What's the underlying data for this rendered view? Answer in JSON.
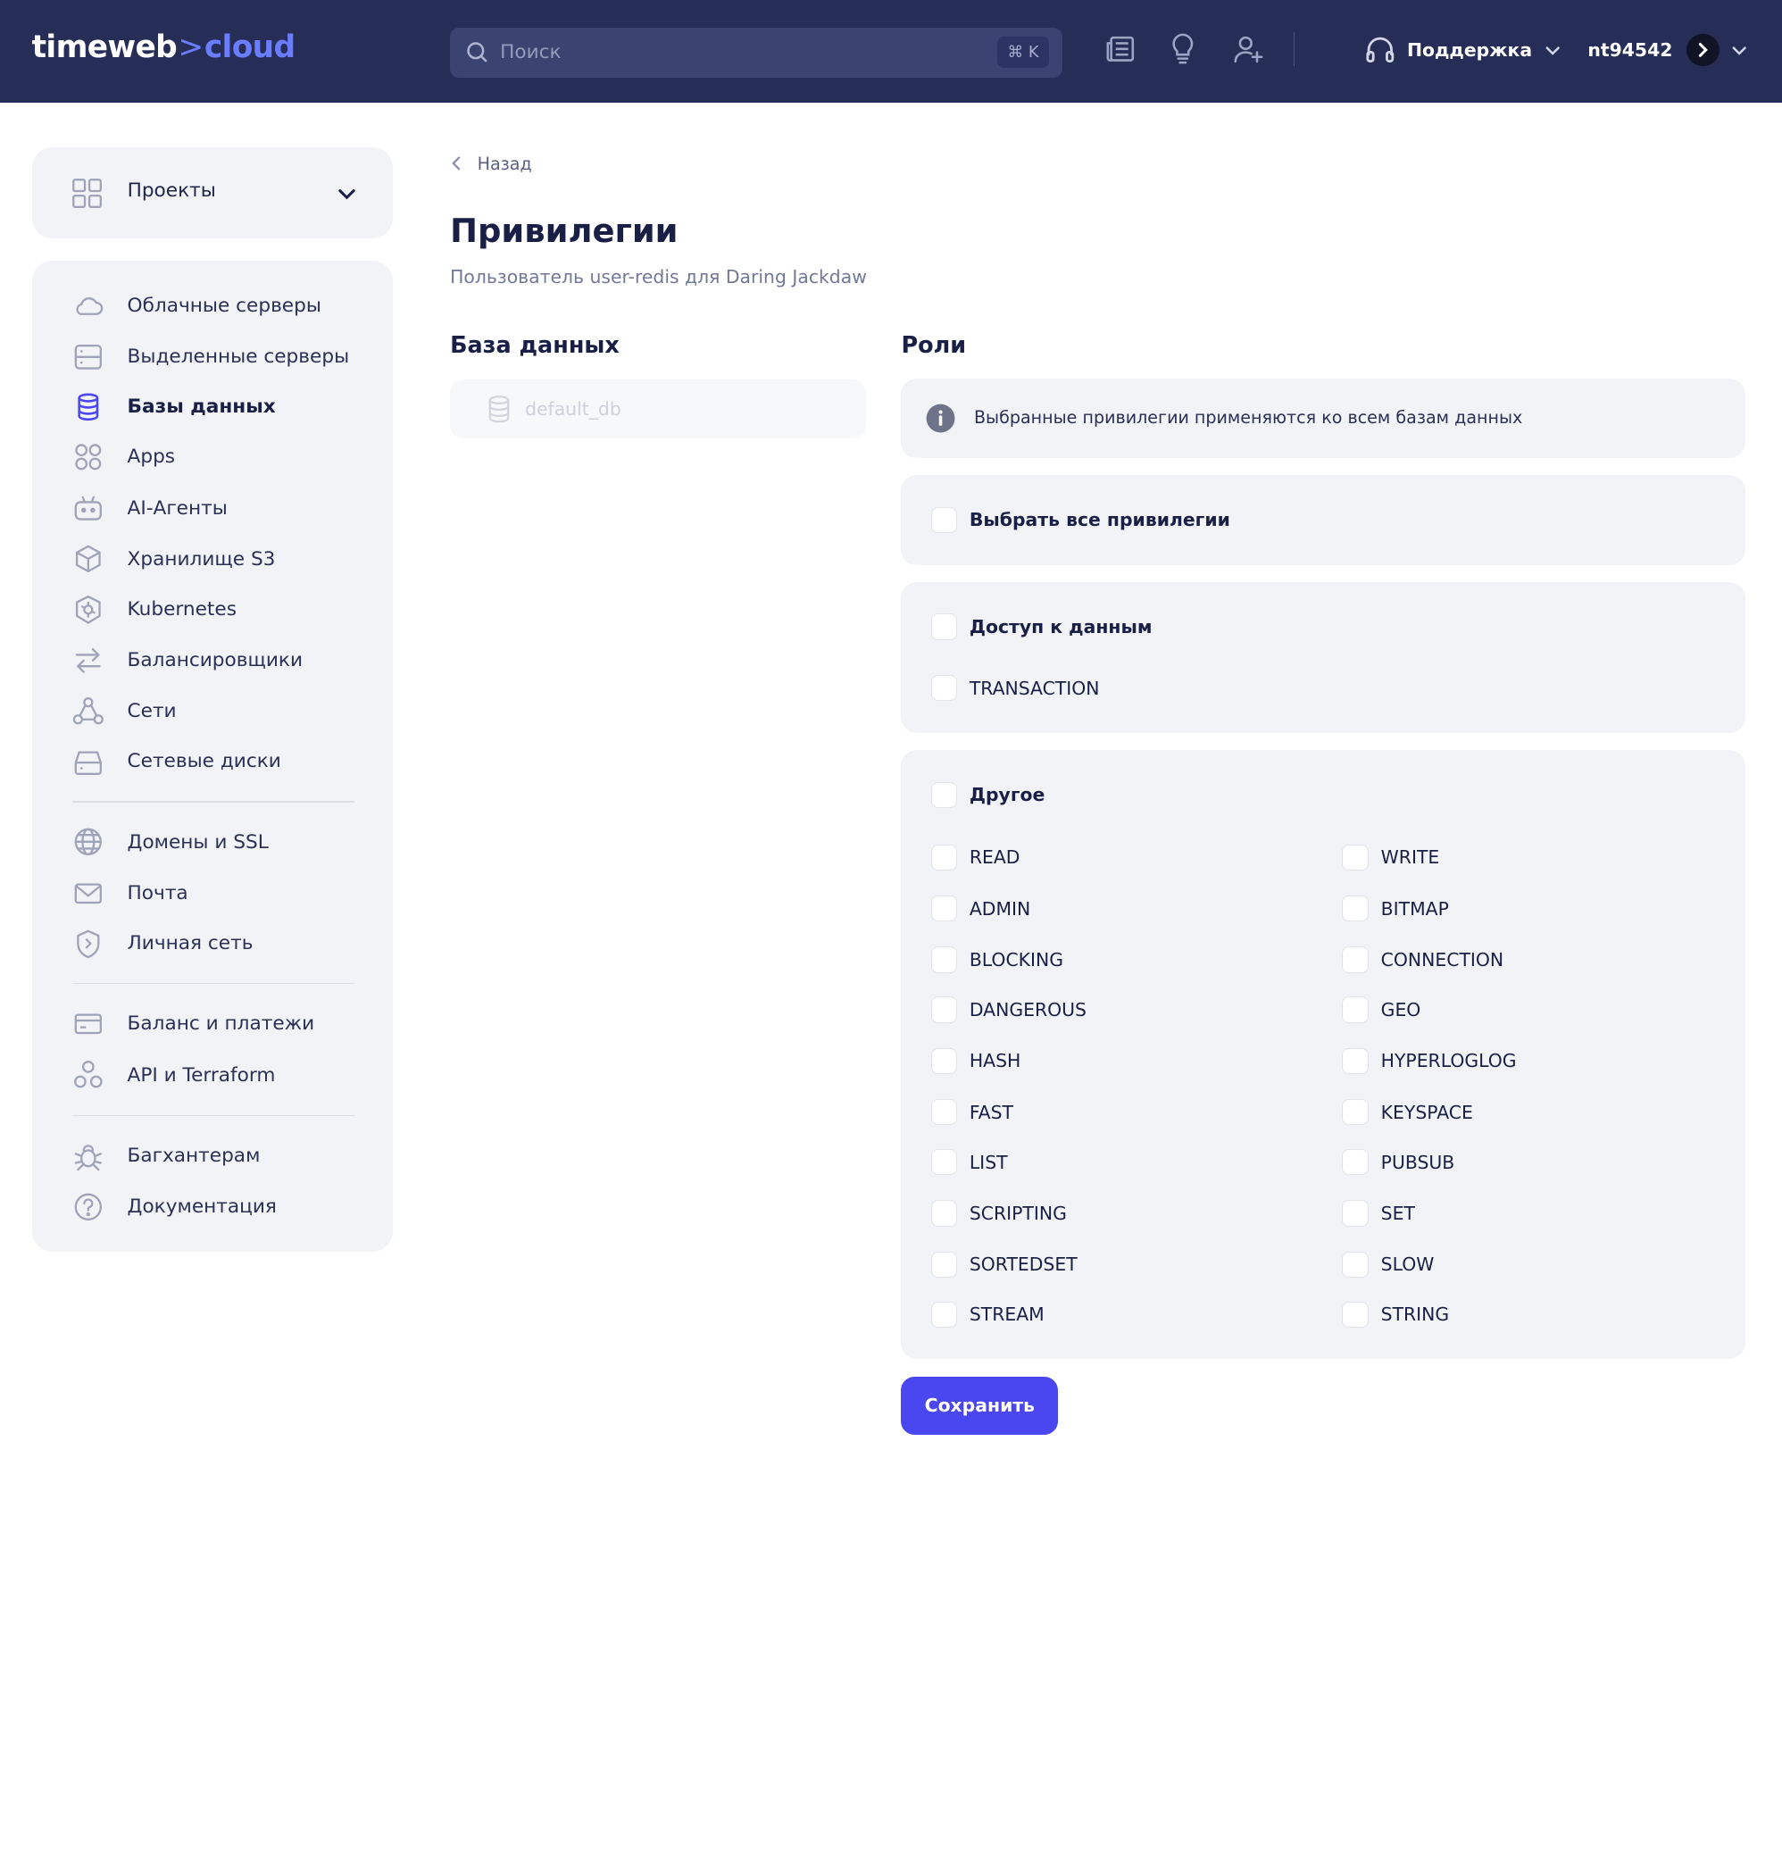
{
  "brand": {
    "part1": "timeweb",
    "separator": ">",
    "part2": "cloud"
  },
  "search": {
    "placeholder": "Поиск",
    "shortcut": "⌘ K"
  },
  "header": {
    "icons": [
      "news-icon",
      "lightbulb-icon",
      "add-user-icon"
    ],
    "support_label": "Поддержка",
    "username": "nt94542"
  },
  "sidebar": {
    "projects_label": "Проекты",
    "group1": [
      {
        "label": "Облачные серверы",
        "icon": "cloud-icon"
      },
      {
        "label": "Выделенные серверы",
        "icon": "server-icon"
      },
      {
        "label": "Базы данных",
        "icon": "database-icon",
        "active": true
      },
      {
        "label": "Apps",
        "icon": "apps-icon"
      },
      {
        "label": "AI-Агенты",
        "icon": "robot-icon"
      },
      {
        "label": "Хранилище S3",
        "icon": "cube-icon"
      },
      {
        "label": "Kubernetes",
        "icon": "kubernetes-icon"
      },
      {
        "label": "Балансировщики",
        "icon": "arrows-icon"
      },
      {
        "label": "Сети",
        "icon": "network-icon"
      },
      {
        "label": "Сетевые диски",
        "icon": "disk-icon"
      }
    ],
    "group2": [
      {
        "label": "Домены и SSL",
        "icon": "globe-icon"
      },
      {
        "label": "Почта",
        "icon": "mail-icon"
      },
      {
        "label": "Личная сеть",
        "icon": "shield-icon"
      }
    ],
    "group3": [
      {
        "label": "Баланс и платежи",
        "icon": "card-icon"
      },
      {
        "label": "API и Terraform",
        "icon": "api-icon"
      }
    ],
    "group4": [
      {
        "label": "Багхантерам",
        "icon": "bug-icon"
      },
      {
        "label": "Документация",
        "icon": "help-icon"
      }
    ]
  },
  "main": {
    "back_label": "Назад",
    "title": "Привилегии",
    "subtitle": "Пользователь user-redis для Daring Jackdaw",
    "db_heading": "База данных",
    "db_item": "default_db",
    "roles_heading": "Роли",
    "info_text": "Выбранные привилегии применяются ко всем базам данных",
    "select_all": "Выбрать все привилегии",
    "data_access_group": {
      "title": "Доступ к данным",
      "items": [
        "TRANSACTION"
      ]
    },
    "other_group": {
      "title": "Другое",
      "left": [
        "READ",
        "ADMIN",
        "BLOCKING",
        "DANGEROUS",
        "HASH",
        "FAST",
        "LIST",
        "SCRIPTING",
        "SORTEDSET",
        "STREAM"
      ],
      "right": [
        "WRITE",
        "BITMAP",
        "CONNECTION",
        "GEO",
        "HYPERLOGLOG",
        "KEYSPACE",
        "PUBSUB",
        "SET",
        "SLOW",
        "STRING"
      ]
    },
    "save_label": "Сохранить"
  },
  "colors": {
    "topbar": "#262e58",
    "accent": "#4a47f0",
    "panel": "#f2f3f6"
  }
}
